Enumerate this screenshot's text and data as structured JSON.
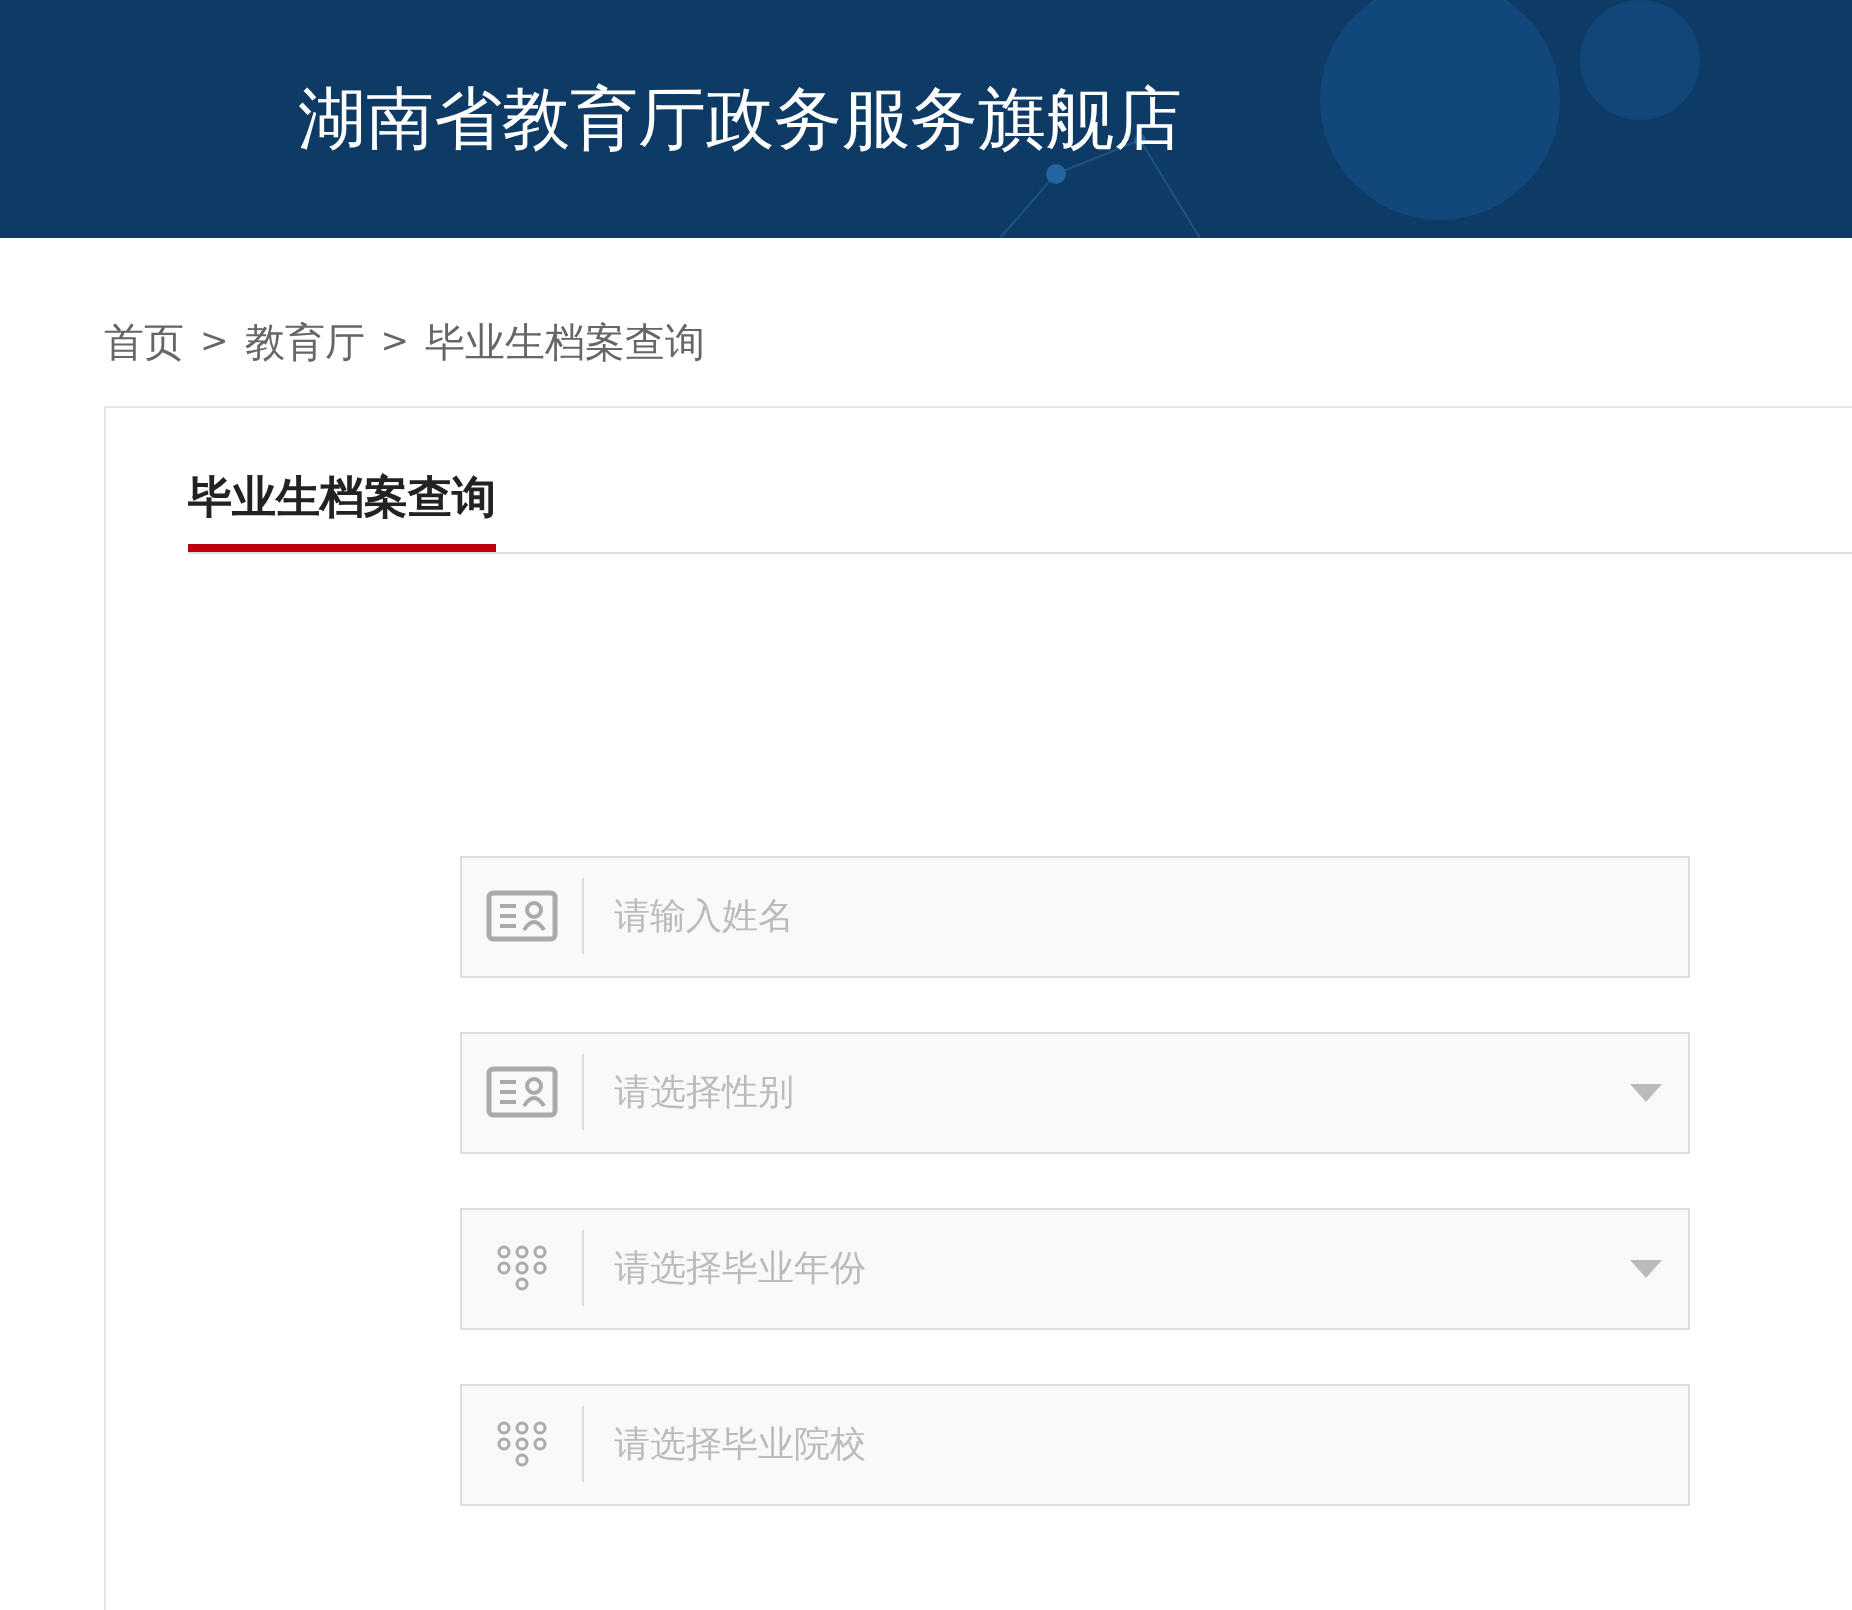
{
  "header": {
    "title": "湖南省教育厅政务服务旗舰店"
  },
  "breadcrumb": [
    {
      "label": "首页"
    },
    {
      "label": "教育厅"
    },
    {
      "label": "毕业生档案查询"
    }
  ],
  "breadcrumb_separator": ">",
  "panel": {
    "title": "毕业生档案查询"
  },
  "fields": [
    {
      "kind": "input",
      "placeholder": "请输入姓名"
    },
    {
      "kind": "select",
      "placeholder": "请选择性别"
    },
    {
      "kind": "select",
      "placeholder": "请选择毕业年份"
    },
    {
      "kind": "input",
      "placeholder": "请选择毕业院校"
    }
  ]
}
